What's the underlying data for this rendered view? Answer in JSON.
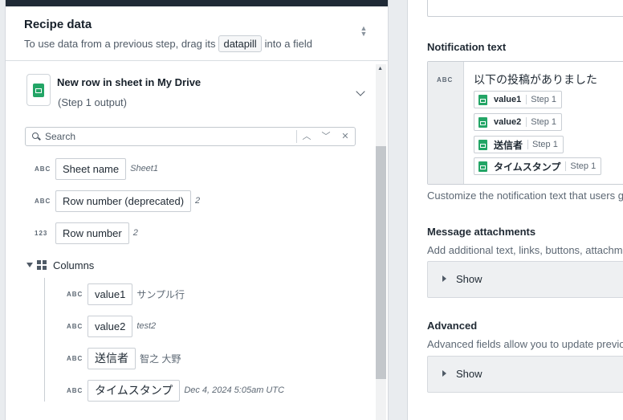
{
  "left_panel": {
    "title": "Recipe data",
    "subtitle_before": "To use data from a previous step, drag its",
    "subtitle_pill": "datapill",
    "subtitle_after": "into a field",
    "step": {
      "title": "New row in sheet in My Drive",
      "subtitle": "(Step 1 output)",
      "icon": "google-sheets-icon"
    },
    "search": {
      "placeholder": "Search",
      "value": ""
    },
    "fields": [
      {
        "type": "ABC",
        "label": "Sheet name",
        "sample": "Sheet1"
      },
      {
        "type": "ABC",
        "label": "Row number (deprecated)",
        "sample": "2"
      },
      {
        "type": "123",
        "label": "Row number",
        "sample": "2"
      }
    ],
    "columns": {
      "label": "Columns",
      "items": [
        {
          "type": "ABC",
          "label": "value1",
          "sample": "サンプル行"
        },
        {
          "type": "ABC",
          "label": "value2",
          "sample": "test2"
        },
        {
          "type": "ABC",
          "label": "送信者",
          "sample": "智之 大野"
        },
        {
          "type": "ABC",
          "label": "タイムスタンプ",
          "sample": "Dec 4, 2024 5:05am UTC"
        }
      ]
    }
  },
  "right_panel": {
    "notification": {
      "label": "Notification text",
      "type": "ABC",
      "text": "以下の投稿がありました",
      "pills": [
        {
          "name": "value1",
          "step": "Step 1"
        },
        {
          "name": "value2",
          "step": "Step 1"
        },
        {
          "name": "送信者",
          "step": "Step 1"
        },
        {
          "name": "タイムスタンプ",
          "step": "Step 1"
        }
      ],
      "help": "Customize the notification text that users g"
    },
    "attachments": {
      "label": "Message attachments",
      "help": "Add additional text, links, buttons, attachm",
      "show_label": "Show"
    },
    "advanced": {
      "label": "Advanced",
      "help": "Advanced fields allow you to update previo",
      "show_label": "Show"
    }
  },
  "colors": {
    "background": "#e9ecef",
    "topbar": "#1f2a36",
    "sheets_green": "#23a566",
    "text_primary": "#1f2933",
    "text_secondary": "#5d6874"
  }
}
